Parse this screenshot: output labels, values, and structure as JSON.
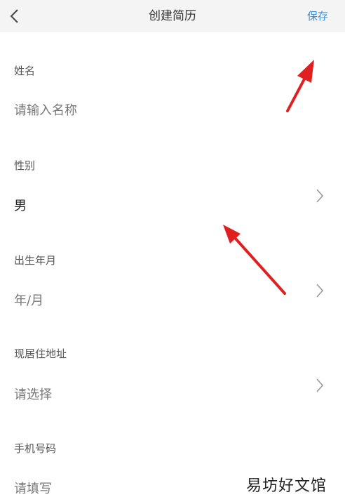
{
  "header": {
    "title": "创建简历",
    "save_label": "保存",
    "back_icon": "chevron-left-icon"
  },
  "fields": [
    {
      "label": "姓名",
      "value": "请输入名称",
      "is_placeholder": true
    },
    {
      "label": "性别",
      "value": "男",
      "is_placeholder": false,
      "has_chevron": true
    },
    {
      "label": "出生年月",
      "value": "年/月",
      "is_placeholder": true,
      "has_chevron": true
    },
    {
      "label": "现居住地址",
      "value": "请选择",
      "is_placeholder": true,
      "has_chevron": true
    },
    {
      "label": "手机号码",
      "value": "请填写",
      "is_placeholder": true
    }
  ],
  "watermark": "易坊好文馆",
  "colors": {
    "accent": "#3a8fdc",
    "annotation_arrow": "#e02020",
    "header_bg": "#f4f4f4"
  }
}
